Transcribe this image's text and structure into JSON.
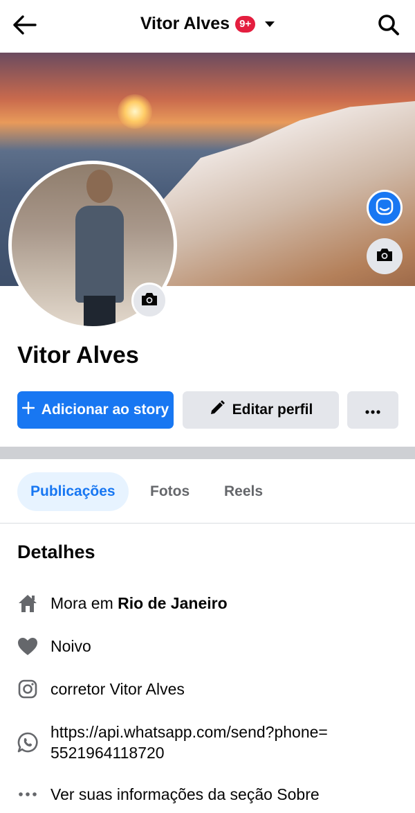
{
  "header": {
    "title": "Vitor Alves",
    "notification_badge": "9+",
    "back_icon": "arrow-left-icon",
    "search_icon": "search-icon"
  },
  "profile": {
    "name": "Vitor Alves"
  },
  "actions": {
    "add_story_label": "Adicionar ao story",
    "edit_profile_label": "Editar perfil",
    "more_label": "···"
  },
  "tabs": [
    {
      "label": "Publicações",
      "active": true
    },
    {
      "label": "Fotos",
      "active": false
    },
    {
      "label": "Reels",
      "active": false
    }
  ],
  "details": {
    "title": "Detalhes",
    "city_prefix": "Mora em ",
    "city": "Rio de Janeiro",
    "relationship": "Noivo",
    "instagram": "corretor Vitor Alves",
    "whatsapp_line1": "https://api.whatsapp.com/send?phone=",
    "whatsapp_line2": "5521964118720",
    "about": "Ver suas informações da seção Sobre"
  },
  "colors": {
    "accent": "#1877f2",
    "badge": "#e41e3f",
    "secondary_button": "#e4e6eb",
    "muted_text": "#65676b"
  }
}
